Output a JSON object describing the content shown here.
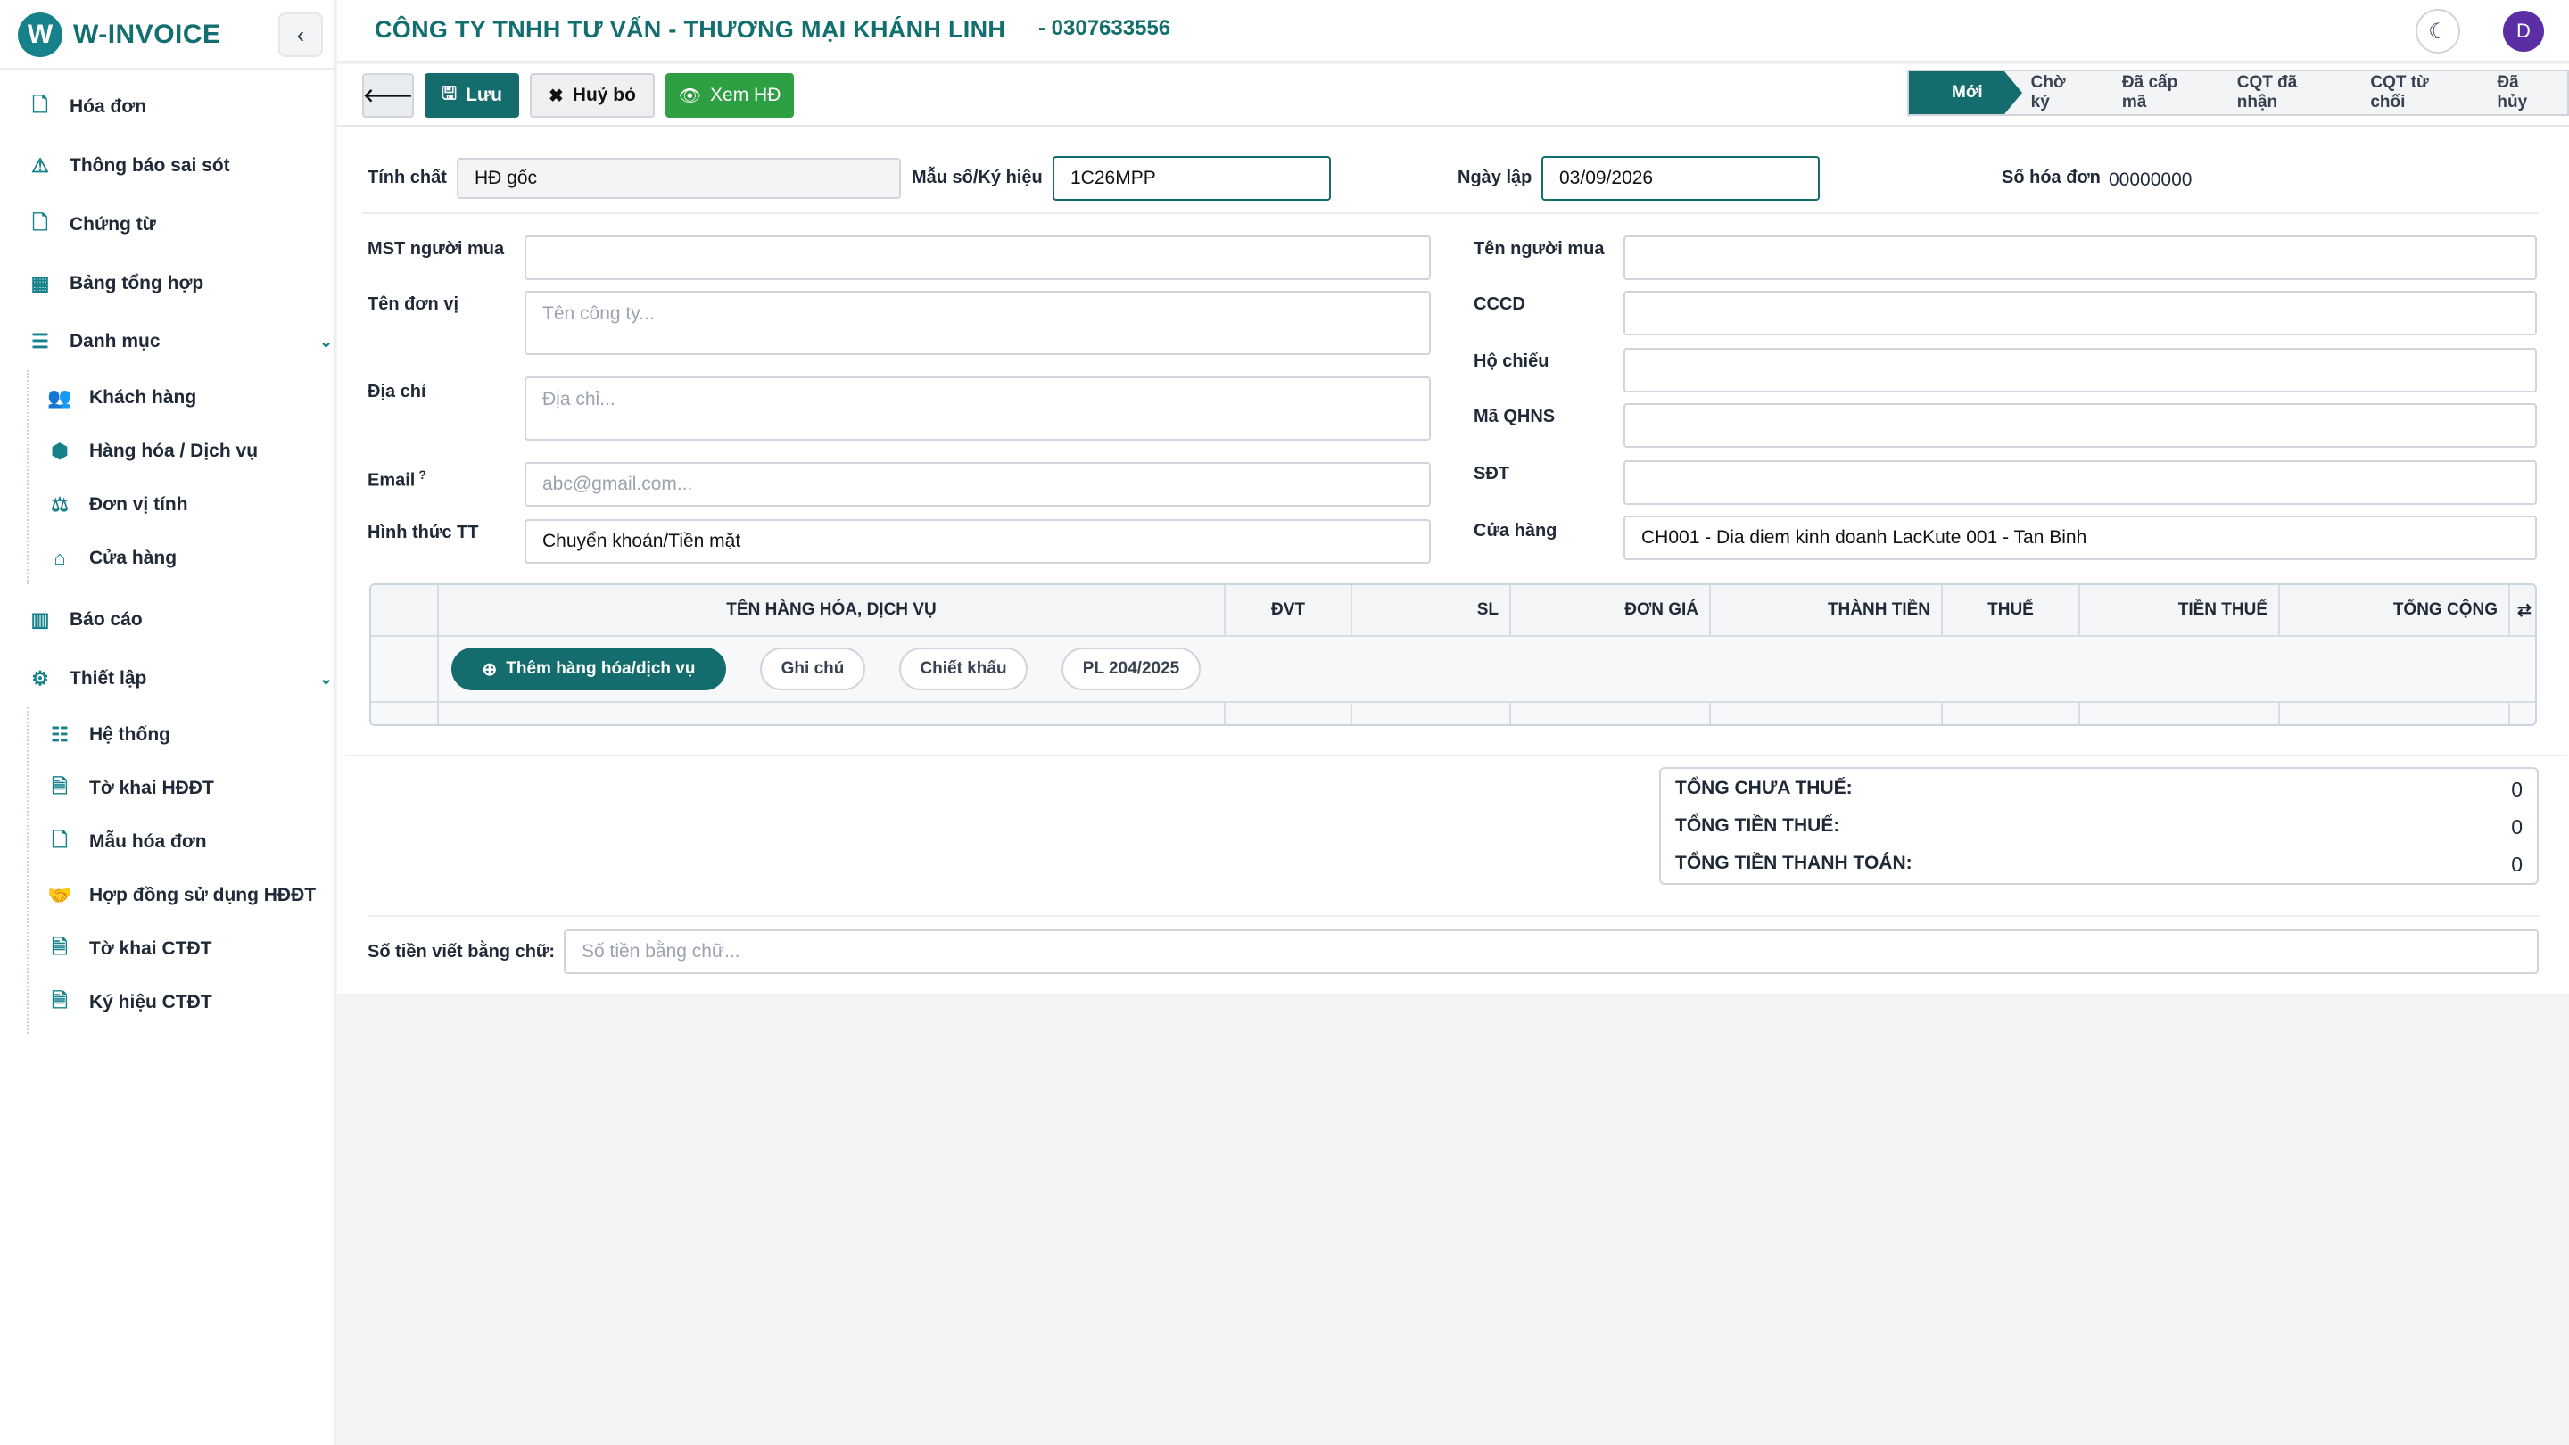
{
  "app": {
    "name": "W-INVOICE",
    "logo_letter": "W"
  },
  "sidebar": {
    "items": [
      {
        "label": "Hóa đơn",
        "icon": "file-icon"
      },
      {
        "label": "Thông báo sai sót",
        "icon": "warning-icon"
      },
      {
        "label": "Chứng từ",
        "icon": "document-icon"
      },
      {
        "label": "Bảng tổng hợp",
        "icon": "table-icon"
      },
      {
        "label": "Danh mục",
        "icon": "list-icon"
      },
      {
        "label": "Báo cáo",
        "icon": "chart-icon"
      },
      {
        "label": "Thiết lập",
        "icon": "cogs-icon"
      }
    ],
    "danh_muc_sub": [
      {
        "label": "Khách hàng",
        "icon": "users-icon"
      },
      {
        "label": "Hàng hóa / Dịch vụ",
        "icon": "boxes-icon"
      },
      {
        "label": "Đơn vị tính",
        "icon": "scale-icon"
      },
      {
        "label": "Cửa hàng",
        "icon": "store-icon"
      }
    ],
    "thiet_lap_sub": [
      {
        "label": "Hệ thống",
        "icon": "sliders-icon"
      },
      {
        "label": "Tờ khai HĐĐT",
        "icon": "file-text-icon"
      },
      {
        "label": "Mẫu hóa đơn",
        "icon": "file-icon"
      },
      {
        "label": "Hợp đồng sử dụng HĐĐT",
        "icon": "handshake-icon"
      },
      {
        "label": "Tờ khai CTĐT",
        "icon": "file-code-icon"
      },
      {
        "label": "Ký hiệu CTĐT",
        "icon": "file-code-icon"
      }
    ]
  },
  "header": {
    "company": "CÔNG TY TNHH TƯ VẤN - THƯƠNG MẠI KHÁNH LINH",
    "tax_id": "- 0307633556",
    "avatar_letter": "D"
  },
  "toolbar": {
    "save": "Lưu",
    "cancel": "Huỷ bỏ",
    "view": "Xem HĐ",
    "statuses": [
      "Mới",
      "Chờ ký",
      "Đã cấp mã",
      "CQT đã nhận",
      "CQT từ chối",
      "Đã hủy"
    ]
  },
  "form": {
    "tinh_chat": {
      "label": "Tính chất",
      "value": "HĐ gốc"
    },
    "mau_so": {
      "label": "Mẫu số/Ký hiệu",
      "value": "1C26MPP"
    },
    "ngay_lap": {
      "label": "Ngày lập",
      "value": "03/09/2026"
    },
    "so_hoa_don": {
      "label": "Số hóa đơn",
      "value": "00000000"
    },
    "mst": {
      "label": "MST người mua",
      "value": ""
    },
    "ten_don_vi": {
      "label": "Tên đơn vị",
      "placeholder": "Tên công ty..."
    },
    "dia_chi": {
      "label": "Địa chỉ",
      "placeholder": "Địa chỉ..."
    },
    "email": {
      "label": "Email",
      "sup": "?",
      "placeholder": "abc@gmail.com..."
    },
    "hinh_thuc_tt": {
      "label": "Hình thức TT",
      "value": "Chuyển khoản/Tiền mặt"
    },
    "ten_nguoi_mua": {
      "label": "Tên người mua",
      "value": ""
    },
    "cccd": {
      "label": "CCCD",
      "value": ""
    },
    "ho_chieu": {
      "label": "Hộ chiếu",
      "value": ""
    },
    "ma_qhns": {
      "label": "Mã QHNS",
      "value": ""
    },
    "sdt": {
      "label": "SĐT",
      "value": ""
    },
    "cua_hang": {
      "label": "Cửa hàng",
      "value": "CH001 - Dia diem kinh doanh LacKute 001 - Tan Binh"
    }
  },
  "items_table": {
    "headers": [
      "TÊN HÀNG HÓA, DỊCH VỤ",
      "ĐVT",
      "SL",
      "ĐƠN GIÁ",
      "THÀNH TIỀN",
      "THUẾ",
      "TIỀN THUẾ",
      "TỔNG CỘNG"
    ],
    "add_item": "Thêm hàng hóa/dịch vụ",
    "note": "Ghi chú",
    "discount": "Chiết khấu",
    "pl": "PL 204/2025"
  },
  "totals": {
    "rows": [
      {
        "label": "Tổng chưa thuế:",
        "value": "0"
      },
      {
        "label": "Tổng tiền thuế:",
        "value": "0"
      },
      {
        "label": "Tổng tiền thanh toán:",
        "value": "0"
      }
    ]
  },
  "amount_in_words": {
    "label": "Số tiền viết bằng chữ:",
    "placeholder": "Số tiền bằng chữ..."
  },
  "colors": {
    "brand": "#146c6c",
    "view_button": "#2ea043",
    "avatar": "#5b2ea6"
  }
}
